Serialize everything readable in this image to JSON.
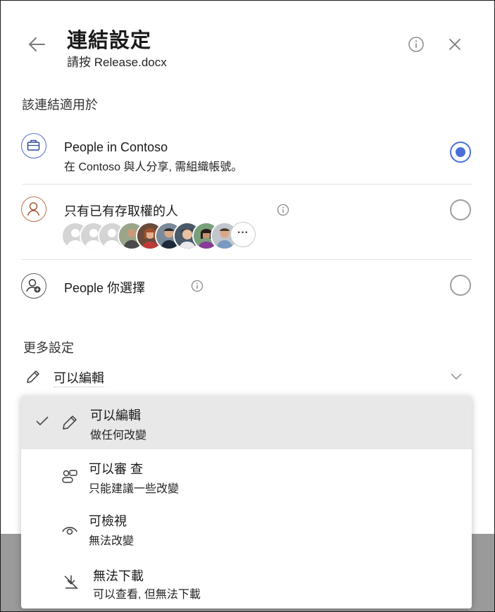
{
  "header": {
    "title": "連結設定",
    "subtitle": "請按 Release.docx"
  },
  "scope": {
    "section_label": "該連結適用於",
    "options": [
      {
        "title": "People in Contoso",
        "description": "在 Contoso 與人分享, 需組織帳號。",
        "selected": true,
        "icon": "briefcase-icon"
      },
      {
        "title": "只有已有存取權的人",
        "selected": false,
        "icon": "person-icon",
        "more_label": "···"
      },
      {
        "title": "People 你選擇",
        "selected": false,
        "icon": "person-add-icon"
      }
    ]
  },
  "more_settings": {
    "section_label": "更多設定",
    "permission_value": "可以編輯"
  },
  "dropdown": {
    "items": [
      {
        "title": "可以編輯",
        "description": "做任何改變",
        "selected": true,
        "icon": "pencil-icon"
      },
      {
        "title": "可以審 查",
        "description": "只能建議一些改變",
        "selected": false,
        "icon": "review-icon"
      },
      {
        "title": "可檢視",
        "description": "無法改變",
        "selected": false,
        "icon": "eye-icon"
      },
      {
        "title": "無法下載",
        "description": "可以查看, 但無法下載",
        "selected": false,
        "icon": "no-download-icon"
      }
    ]
  },
  "colors": {
    "accent": "#4a6fd8",
    "selected_row_bg": "#e8e8e8",
    "backdrop": "#9a9a9a"
  }
}
